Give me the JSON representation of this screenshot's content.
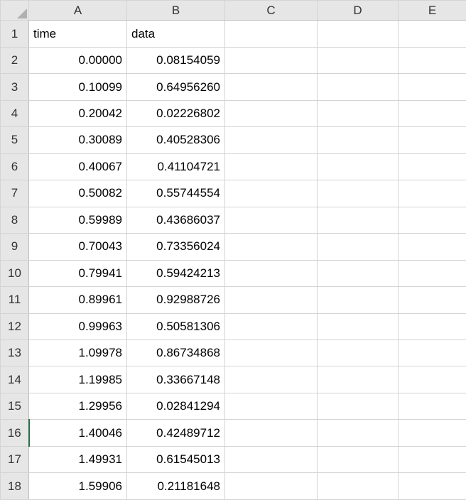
{
  "columns": [
    "A",
    "B",
    "C",
    "D",
    "E"
  ],
  "row_numbers": [
    1,
    2,
    3,
    4,
    5,
    6,
    7,
    8,
    9,
    10,
    11,
    12,
    13,
    14,
    15,
    16,
    17,
    18
  ],
  "selected_row_header": 16,
  "headers": {
    "A": "time",
    "B": "data"
  },
  "rows": [
    {
      "A": "0.00000",
      "B": "0.08154059"
    },
    {
      "A": "0.10099",
      "B": "0.64956260"
    },
    {
      "A": "0.20042",
      "B": "0.02226802"
    },
    {
      "A": "0.30089",
      "B": "0.40528306"
    },
    {
      "A": "0.40067",
      "B": "0.41104721"
    },
    {
      "A": "0.50082",
      "B": "0.55744554"
    },
    {
      "A": "0.59989",
      "B": "0.43686037"
    },
    {
      "A": "0.70043",
      "B": "0.73356024"
    },
    {
      "A": "0.79941",
      "B": "0.59424213"
    },
    {
      "A": "0.89961",
      "B": "0.92988726"
    },
    {
      "A": "0.99963",
      "B": "0.50581306"
    },
    {
      "A": "1.09978",
      "B": "0.86734868"
    },
    {
      "A": "1.19985",
      "B": "0.33667148"
    },
    {
      "A": "1.29956",
      "B": "0.02841294"
    },
    {
      "A": "1.40046",
      "B": "0.42489712"
    },
    {
      "A": "1.49931",
      "B": "0.61545013"
    },
    {
      "A": "1.59906",
      "B": "0.21181648"
    }
  ]
}
